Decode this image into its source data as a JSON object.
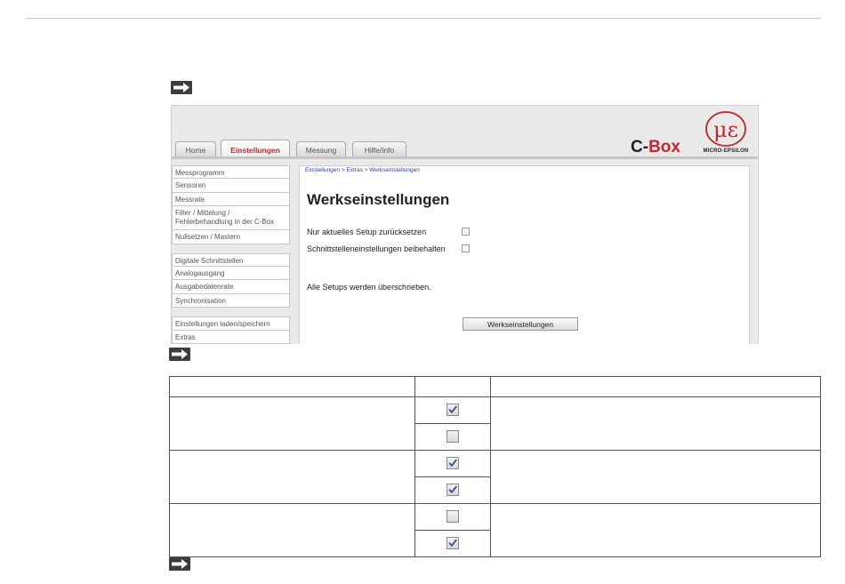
{
  "screenshot": {
    "tabs": [
      {
        "label": "Home",
        "active": false
      },
      {
        "label": "Einstellungen",
        "active": true
      },
      {
        "label": "Messung",
        "active": false
      },
      {
        "label": "Hilfe/Info",
        "active": false
      }
    ],
    "brand_prefix": "C-",
    "brand_suffix": "Box",
    "logo_text": "MICRO-EPSILON",
    "sidebar_group1": [
      "Messprogramm",
      "Sensoren",
      "Messrate",
      "Filter / Mittelung / Fehlerbehandlung in der C-Box",
      "Nullsetzen / Mastern"
    ],
    "sidebar_group2": [
      "Digitale Schnittstellen",
      "Analogausgang",
      "Ausgabedatenrate",
      "Synchronisation"
    ],
    "sidebar_group3": [
      "Einstellungen laden/speichern",
      "Extras"
    ],
    "breadcrumb": "Einstellungen > Extras > Werkseinstellungen",
    "title": "Werkseinstellungen",
    "option1": "Nur aktuelles Setup zurücksetzen",
    "option2": "Schnittstelleneinstellungen beibehalten",
    "note": "Alle Setups werden überschrieben.",
    "button": "Werkseinstellungen"
  },
  "table": {
    "rows": [
      {
        "checked": [
          true,
          false
        ]
      },
      {
        "checked": [
          true,
          true
        ]
      },
      {
        "checked": [
          false,
          true
        ]
      }
    ]
  },
  "colors": {
    "accent_red": "#c0282f",
    "link_blue": "#2a3eb1"
  }
}
